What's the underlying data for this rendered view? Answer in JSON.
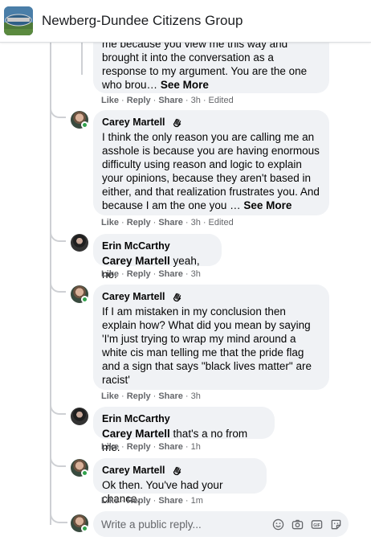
{
  "group": {
    "title": "Newberg-Dundee Citizens Group",
    "logo_icon": "group-logo-icon"
  },
  "comments": [
    {
      "author": "",
      "body_lines": [
        "me because you view me this way and",
        "brought it into the conversation as a",
        "response to my argument. You are the one",
        "who brou…"
      ],
      "see_more": "See More",
      "actions": {
        "like": "Like",
        "reply": "Reply",
        "share": "Share",
        "time": "3h",
        "edited": "Edited"
      }
    },
    {
      "author": "Carey Martell",
      "body_lines": [
        "I think the only reason you are calling me an",
        "asshole is because you are having enormous",
        "difficulty using reason and logic to explain",
        "your opinions, because they aren't based in",
        "either, and that realization frustrates you. And",
        "because I am the one you …"
      ],
      "see_more": "See More",
      "actions": {
        "like": "Like",
        "reply": "Reply",
        "share": "Share",
        "time": "3h",
        "edited": "Edited"
      }
    },
    {
      "author": "Erin McCarthy",
      "mention": "Carey Martell",
      "body": " yeah, no.",
      "actions": {
        "like": "Like",
        "reply": "Reply",
        "share": "Share",
        "time": "3h"
      }
    },
    {
      "author": "Carey Martell",
      "body_lines": [
        "If I am mistaken in my conclusion then",
        "explain how? What did you mean by saying",
        "'I'm just trying to wrap my mind around a",
        "white cis man telling me that the pride flag",
        "and a sign that says \"black lives matter\" are",
        "racist'"
      ],
      "actions": {
        "like": "Like",
        "reply": "Reply",
        "share": "Share",
        "time": "3h"
      }
    },
    {
      "author": "Erin McCarthy",
      "mention": "Carey Martell",
      "body": " that's a no from me.",
      "actions": {
        "like": "Like",
        "reply": "Reply",
        "share": "Share",
        "time": "1h"
      }
    },
    {
      "author": "Carey Martell",
      "body": "Ok then. You've had your chance.",
      "actions": {
        "like": "Like",
        "reply": "Reply",
        "share": "Share",
        "time": "1m"
      }
    }
  ],
  "composer": {
    "placeholder": "Write a public reply...",
    "icons": [
      "emoji-icon",
      "camera-icon",
      "gif-icon",
      "sticker-icon"
    ]
  },
  "colors": {
    "bubble": "#f0f2f5",
    "meta_text": "#65676b",
    "online": "#31a24c",
    "thread_line": "#ced0d4"
  }
}
